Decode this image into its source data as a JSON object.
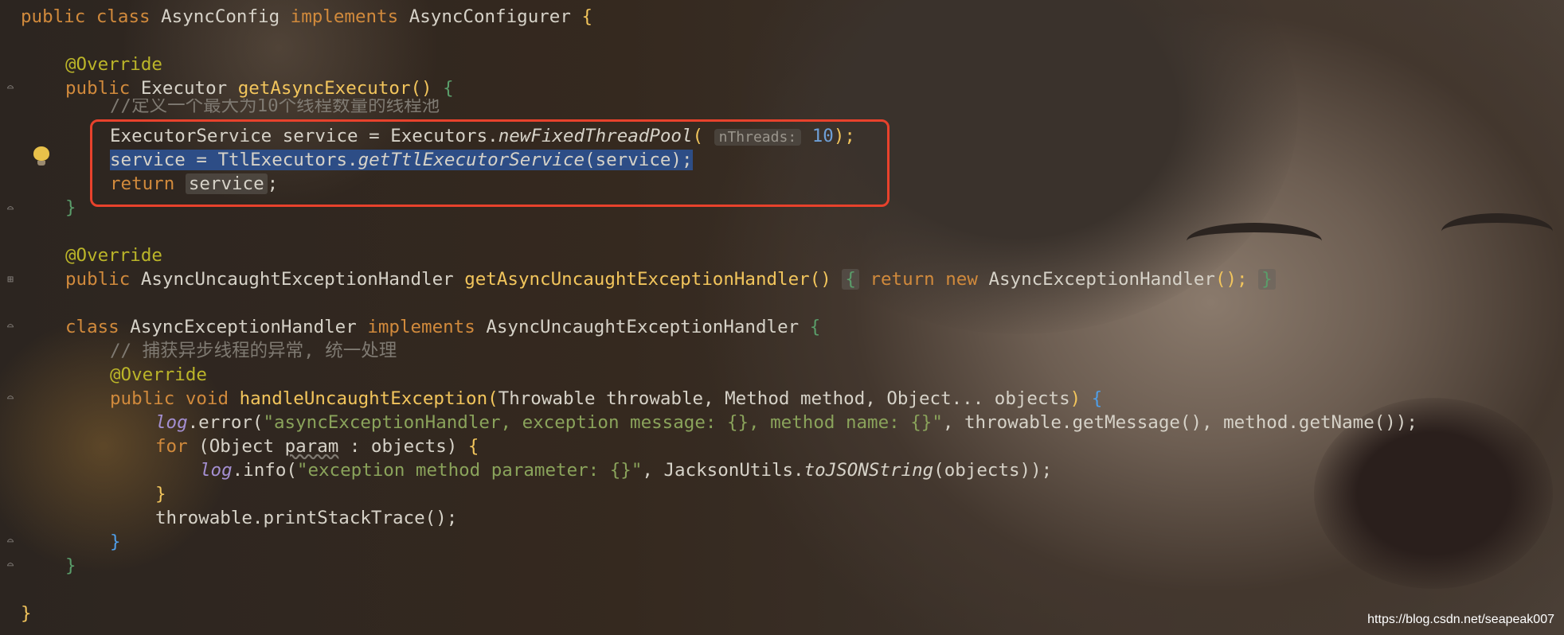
{
  "code": {
    "l0": {
      "kw1": "public",
      "kw2": "class",
      "name": "AsyncConfig",
      "kw3": "implements",
      "iface": "AsyncConfigurer",
      "brace": "{"
    },
    "l1": {
      "ann": "@Override"
    },
    "l2": {
      "kw": "public",
      "type": "Executor",
      "fn": "getAsyncExecutor",
      "paren": "()",
      "brace": "{"
    },
    "l3": {
      "comment": "//定义一个最大为10个线程数量的线程池"
    },
    "l4": {
      "type": "ExecutorService",
      "var": "service",
      "eq": "=",
      "cls": "Executors.",
      "fn": "newFixedThreadPool",
      "open": "(",
      "hint": "nThreads:",
      "num": "10",
      "close": ");"
    },
    "l5": {
      "text1": "service = TtlExecutors.",
      "fn": "getTtlExecutorService",
      "text2": "(service);"
    },
    "l6": {
      "kw": "return",
      "var": "service",
      "end": ";"
    },
    "l7": {
      "brace": "}"
    },
    "l8": {
      "ann": "@Override"
    },
    "l9": {
      "kw": "public",
      "type": "AsyncUncaughtExceptionHandler",
      "fn": "getAsyncUncaughtExceptionHandler",
      "paren": "()",
      "ob": "{",
      "kw2": "return",
      "kw3": "new",
      "cls": "AsyncExceptionHandler",
      "call": "();",
      "cb": "}"
    },
    "l10": {
      "kw1": "class",
      "name": "AsyncExceptionHandler",
      "kw2": "implements",
      "iface": "AsyncUncaughtExceptionHandler",
      "brace": "{"
    },
    "l11": {
      "comment": "// 捕获异步线程的异常, 统一处理"
    },
    "l12": {
      "ann": "@Override"
    },
    "l13": {
      "kw1": "public",
      "kw2": "void",
      "fn": "handleUncaughtException",
      "open": "(",
      "params": "Throwable throwable, Method method, Object... objects",
      "close": ")",
      "brace": "{"
    },
    "l14": {
      "log": "log",
      "call": ".error(",
      "str": "\"asyncExceptionHandler, exception message: {}, method name: {}\"",
      "rest": ", throwable.getMessage(), method.getName());"
    },
    "l15": {
      "kw": "for",
      "open": " (Object ",
      "param": "param",
      "rest": " : objects) ",
      "brace": "{"
    },
    "l16": {
      "log": "log",
      "call": ".info(",
      "str": "\"exception method parameter: {}\"",
      "mid": ", JacksonUtils.",
      "fn": "toJSONString",
      "rest": "(objects));"
    },
    "l17": {
      "brace": "}"
    },
    "l18": {
      "text": "throwable.printStackTrace();"
    },
    "l19": {
      "brace": "}"
    },
    "l20": {
      "brace": "}"
    },
    "l21": {
      "brace": "}"
    }
  },
  "watermark": "https://blog.csdn.net/seapeak007",
  "colors": {
    "highlight_box": "#e8422c",
    "selection": "#2d4d86",
    "keyword": "#d18a3c",
    "annotation": "#bbb529"
  }
}
